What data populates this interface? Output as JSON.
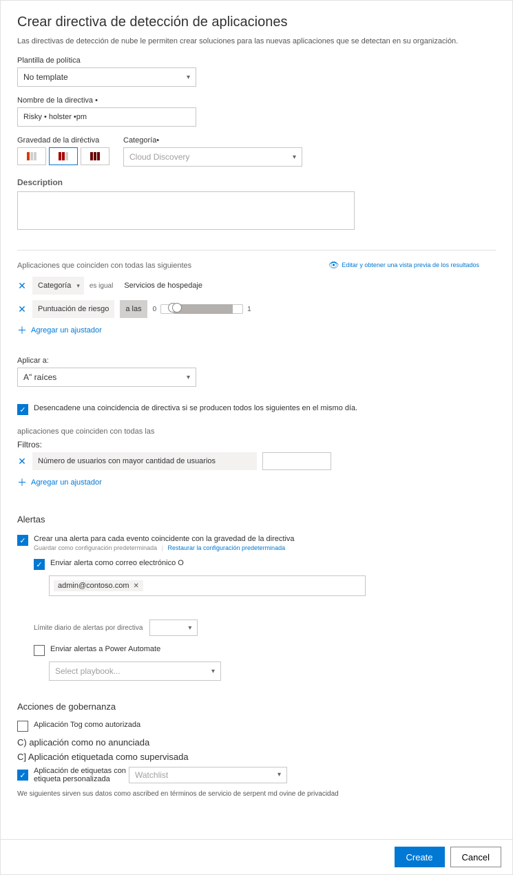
{
  "header": {
    "title": "Crear directiva de detección de aplicaciones",
    "subtitle": "Las directivas de detección de nube le permiten crear soluciones para las nuevas aplicaciones que se detectan en su organización."
  },
  "template": {
    "label": "Plantilla de política",
    "value": "No template"
  },
  "name": {
    "label": "Nombre de la directiva •",
    "value": "Risky • holster •pm"
  },
  "severity": {
    "label": "Gravedad de la diréctiva"
  },
  "category": {
    "label": "Categoría•",
    "value": "Cloud Discovery"
  },
  "description": {
    "label": "Description",
    "value": ""
  },
  "matchHeader": "Aplicaciones que coinciden con todas las siguientes",
  "previewLink": "Editar y obtener una vista previa de los resultados",
  "filter1": {
    "field": "Categoría",
    "op": "es igual",
    "value": "Servicios de hospedaje"
  },
  "filter2": {
    "field": "Puntuación de riesgo",
    "op": "a las",
    "min": "0",
    "max": "1"
  },
  "addFilter": "Agregar un ajustador",
  "applyTo": {
    "label": "Aplicar a:",
    "value": "A\" raíces"
  },
  "triggerCheck": "Desencadene una coincidencia de directiva si se producen todos los siguientes en el mismo día.",
  "appsHeader": "aplicaciones que coinciden con todas las",
  "filtersHead": "Filtros:",
  "filter3": {
    "text": "Número de usuarios con mayor cantidad de usuarios"
  },
  "alerts": {
    "heading": "Alertas",
    "createAlert": "Crear una alerta para cada evento coincidente con la gravedad de la directiva",
    "saveDefault": "Guardar como configuración predeterminada",
    "restoreDefault": "Restaurar la configuración predeterminada",
    "emailCheck": "Enviar alerta como correo electrónico O",
    "email": "admin@contoso.com",
    "dailyLimit": "Límite diario de alertas por directiva",
    "powerAutomate": "Enviar alertas a Power Automate",
    "playbookPlaceholder": "Select playbook..."
  },
  "governance": {
    "heading": "Acciones de gobernanza",
    "tagAuthorized": "Aplicación Tog como autorizada",
    "lineC1": "C) aplicación como no anunciada",
    "lineC2": "C] Aplicación etiquetada como supervisada",
    "customTag": "Aplicación de etiquetas con etiqueta personalizada",
    "watchlist": "Watchlist"
  },
  "policyNote": "We siguientes sirven sus datos como ascribed en términos de servicio de serpent md ovine de privacidad",
  "buttons": {
    "create": "Create",
    "cancel": "Cancel"
  }
}
